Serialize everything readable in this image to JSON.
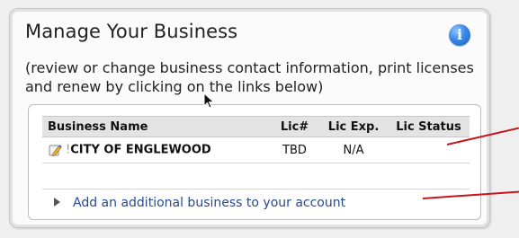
{
  "panel": {
    "title": "Manage Your Business",
    "info_icon": "info-icon",
    "description": "(review or change business contact information, print licenses and renew by clicking on the links below)"
  },
  "table": {
    "headers": [
      "Business Name",
      "Lic#",
      "Lic Exp.",
      "Lic Status"
    ],
    "rows": [
      {
        "icon": "edit-pencil-icon",
        "name": "CITY OF ENGLEWOOD",
        "lic": "TBD",
        "exp": "N/A",
        "status": ""
      }
    ]
  },
  "add_link": {
    "label": "Add an additional business to your account",
    "icon": "expand-triangle-icon"
  },
  "colors": {
    "panel_bg": "#fbfbfb",
    "header_bg": "#e3e3e3",
    "link": "#274b8f",
    "annotation": "#c4161c",
    "info": "#3b88e6"
  }
}
